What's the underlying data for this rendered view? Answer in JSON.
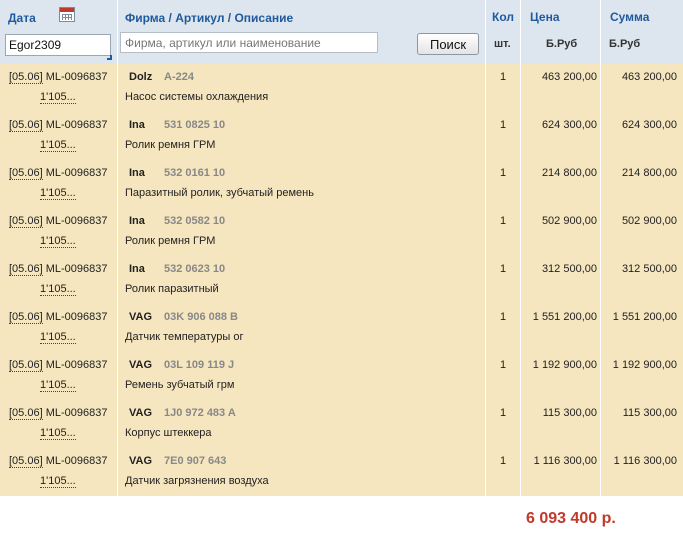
{
  "header": {
    "date_label": "Дата",
    "firm_label": "Фирма",
    "article_label": "Артикул",
    "description_label": "Описание",
    "separator": " / ",
    "qty_label": "Кол",
    "qty_unit": "шт.",
    "price_label": "Цена",
    "price_unit": "Б.Руб",
    "sum_label": "Сумма",
    "sum_unit": "Б.Руб"
  },
  "filters": {
    "user_value": "Egor2309",
    "search_placeholder": "Фирма, артикул или наименование",
    "search_button": "Поиск"
  },
  "rows": [
    {
      "date": "[05.06]",
      "order": "ML-0096837",
      "sub": "1'105...",
      "brand": "Dolz",
      "article": "A-224",
      "description": "Насос системы охлаждения",
      "qty": "1",
      "price": "463 200,00",
      "sum": "463 200,00"
    },
    {
      "date": "[05.06]",
      "order": "ML-0096837",
      "sub": "1'105...",
      "brand": "Ina",
      "article": "531 0825 10",
      "description": "Ролик ремня ГРМ",
      "qty": "1",
      "price": "624 300,00",
      "sum": "624 300,00"
    },
    {
      "date": "[05.06]",
      "order": "ML-0096837",
      "sub": "1'105...",
      "brand": "Ina",
      "article": "532 0161 10",
      "description": "Паразитный ролик, зубчатый ремень",
      "qty": "1",
      "price": "214 800,00",
      "sum": "214 800,00"
    },
    {
      "date": "[05.06]",
      "order": "ML-0096837",
      "sub": "1'105...",
      "brand": "Ina",
      "article": "532 0582 10",
      "description": "Ролик ремня ГРМ",
      "qty": "1",
      "price": "502 900,00",
      "sum": "502 900,00"
    },
    {
      "date": "[05.06]",
      "order": "ML-0096837",
      "sub": "1'105...",
      "brand": "Ina",
      "article": "532 0623 10",
      "description": "Ролик паразитный",
      "qty": "1",
      "price": "312 500,00",
      "sum": "312 500,00"
    },
    {
      "date": "[05.06]",
      "order": "ML-0096837",
      "sub": "1'105...",
      "brand": "VAG",
      "article": "03K 906 088 B",
      "description": "Датчик температуры ог",
      "qty": "1",
      "price": "1 551 200,00",
      "sum": "1 551 200,00"
    },
    {
      "date": "[05.06]",
      "order": "ML-0096837",
      "sub": "1'105...",
      "brand": "VAG",
      "article": "03L 109 119 J",
      "description": "Ремень зубчатый грм",
      "qty": "1",
      "price": "1 192 900,00",
      "sum": "1 192 900,00"
    },
    {
      "date": "[05.06]",
      "order": "ML-0096837",
      "sub": "1'105...",
      "brand": "VAG",
      "article": "1J0 972 483 A",
      "description": "Корпус штеккера",
      "qty": "1",
      "price": "115 300,00",
      "sum": "115 300,00"
    },
    {
      "date": "[05.06]",
      "order": "ML-0096837",
      "sub": "1'105...",
      "brand": "VAG",
      "article": "7E0 907 643",
      "description": "Датчик загрязнения воздуха",
      "qty": "1",
      "price": "1 116 300,00",
      "sum": "1 116 300,00"
    }
  ],
  "total": "6 093 400 р."
}
